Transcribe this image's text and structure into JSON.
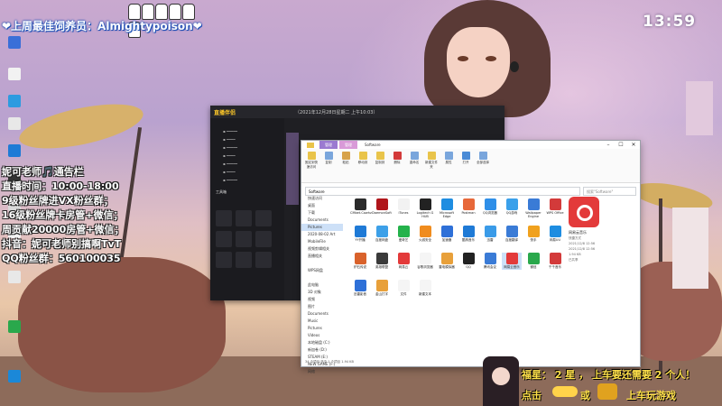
{
  "overlay": {
    "banner": "❤上周最佳饲养员：Almightypoison❤",
    "clock": "13:59",
    "notice_lines": [
      "妮可老师🎵通告栏",
      "直播时间：10:00-18:00",
      "9级粉丝牌进VX粉丝群；",
      "16级粉丝牌卡房管+微信；",
      "周贡献20000房管+微信；",
      "抖音：妮可老师别搞啊TvT",
      "QQ粉丝群：560100035"
    ],
    "bottom_line1": "福星： 2 星 ， 上车要还需要 2 个人！",
    "bottom_line2_left": "点击",
    "bottom_line2_mid": "或",
    "bottom_line2_right": "上车玩游戏"
  },
  "desktop_icons": [
    {
      "label": "",
      "color": "#3a6fd8"
    },
    {
      "label": "",
      "color": "#f2f2f2"
    },
    {
      "label": "",
      "color": "#2d9be0"
    },
    {
      "label": "",
      "color": "#e8e8e8"
    },
    {
      "label": "",
      "color": "#1e7bd6"
    },
    {
      "label": "",
      "color": "#333"
    },
    {
      "label": "",
      "color": "#d9d9d9"
    },
    {
      "label": "",
      "color": "#f2f2f2"
    },
    {
      "label": "",
      "color": "#e8e8e8"
    },
    {
      "label": "",
      "color": "#2aa84c"
    },
    {
      "label": "",
      "color": "#1b88d8"
    }
  ],
  "app": {
    "logo": "直播伴侣",
    "title": "（2021年12月28日星期二 上午10:03）",
    "side_rows": [
      "",
      "",
      "",
      "",
      "",
      "",
      ""
    ],
    "side_section": "工具箱"
  },
  "explorer": {
    "tabs": [
      "管理",
      "管理",
      "Software"
    ],
    "controls": [
      "–",
      "☐",
      "✕"
    ],
    "ribbon": [
      {
        "label": "固定到快速访问",
        "color": "#e9c44a"
      },
      {
        "label": "复制",
        "color": "#7aa6dc"
      },
      {
        "label": "粘贴",
        "color": "#d7a24a"
      },
      {
        "label": "移动到",
        "color": "#e9c44a"
      },
      {
        "label": "复制到",
        "color": "#e9c44a"
      },
      {
        "label": "删除",
        "color": "#d33a3a"
      },
      {
        "label": "重命名",
        "color": "#7aa6dc"
      },
      {
        "label": "新建文件夹",
        "color": "#e9c44a"
      },
      {
        "label": "属性",
        "color": "#7aa6dc"
      },
      {
        "label": "打开",
        "color": "#4a8bd6"
      },
      {
        "label": "全部选择",
        "color": "#7aa6dc"
      }
    ],
    "address": "Software",
    "search_placeholder": "搜索\"Software\"",
    "nav": [
      "快速访问",
      "桌面",
      "下载",
      "Documents",
      "Pictures",
      "2020-08-02 Art",
      "MobileFile",
      "视频剪辑相关",
      "直播相关",
      "",
      "WPS网盘",
      "",
      "此电脑",
      "3D 对象",
      "视频",
      "图片",
      "Documents",
      "Music",
      "Pictures",
      "Videos",
      "本地磁盘 (C:)",
      "新加卷 (D:)",
      "STEAM (E:)",
      "NEW GAME (F:)",
      "网络"
    ],
    "files_row1": [
      {
        "label": "CMbet.Cowhz",
        "color": "#2b2b2b"
      },
      {
        "label": "DaemonSoft",
        "color": "#b0161b"
      },
      {
        "label": "iTunes",
        "color": "#f2f2f2"
      },
      {
        "label": "Logitech G HUB",
        "color": "#222"
      },
      {
        "label": "Microsoft Edge",
        "color": "#1e8de1"
      },
      {
        "label": "Postman",
        "color": "#e7683a"
      },
      {
        "label": "QQ浏览器",
        "color": "#2f8fe8"
      },
      {
        "label": "QQ游戏",
        "color": "#3aa0ea"
      },
      {
        "label": "Wallpaper Engine",
        "color": "#3a7bd6"
      },
      {
        "label": "WPS Office",
        "color": "#d33a3a"
      }
    ],
    "files_row2": [
      {
        "label": "YY开播",
        "color": "#1f7ad6"
      },
      {
        "label": "百度网盘",
        "color": "#3da0e8"
      },
      {
        "label": "爱奇艺",
        "color": "#24b24b"
      },
      {
        "label": "火绒安全",
        "color": "#f08c1e"
      },
      {
        "label": "加速器",
        "color": "#2e70d8"
      },
      {
        "label": "酷狗音乐",
        "color": "#1f7ad6"
      },
      {
        "label": "迅雷",
        "color": "#3a9be8"
      },
      {
        "label": "百度翻译",
        "color": "#3a7bd6"
      },
      {
        "label": "快手",
        "color": "#f0a11e"
      },
      {
        "label": "网易UU",
        "color": "#1e8de1"
      }
    ],
    "files_row3": [
      {
        "label": "炉石传说",
        "color": "#d9622b"
      },
      {
        "label": "英雄联盟",
        "color": "#3a3a3a"
      },
      {
        "label": "网易云",
        "color": "#e33a3a"
      },
      {
        "label": "谷歌浏览器",
        "color": "#f5f5f5"
      },
      {
        "label": "雷电模拟器",
        "color": "#e8a03a"
      },
      {
        "label": "QQ",
        "color": "#222"
      },
      {
        "label": "腾讯会议",
        "color": "#3a7bd6"
      },
      {
        "label": "网易云音乐",
        "color": "#e33a3a"
      },
      {
        "label": "微信",
        "color": "#2aa84c"
      },
      {
        "label": "千千音乐",
        "color": "#d33a3a"
      }
    ],
    "files_row4": [
      {
        "label": "迅雷影音",
        "color": "#2e70d8"
      },
      {
        "label": "金山打字",
        "color": "#e8a03a"
      },
      {
        "label": "文件",
        "color": "#f5f5f5"
      },
      {
        "label": "新建文本",
        "color": "#f5f5f5"
      }
    ],
    "preview_title": "网易云音乐",
    "preview_rows": [
      "快捷方式",
      "2021/12/8 12:56",
      "2021/12/8 12:56",
      "1.94 KB",
      "已共享"
    ],
    "status": "34 个项目    选中 1 个项目  1.94 KB"
  }
}
